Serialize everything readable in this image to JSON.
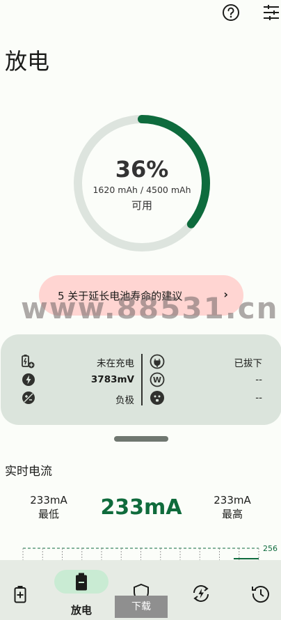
{
  "header": {
    "title": "放电",
    "help_icon": "help-circle-icon",
    "settings_icon": "tune-sliders-icon"
  },
  "gauge": {
    "percent_label": "36%",
    "percent": 36,
    "capacity": "1620 mAh / 4500 mAh",
    "available": "可用",
    "accent": "#0e6b3d",
    "track": "#dde4de"
  },
  "tips": {
    "label": "5 关于延长电池寿命的建议",
    "chevron": "›"
  },
  "watermark": {
    "text1": "www.88531.cn",
    "text2": "www.88531.cn"
  },
  "stats": {
    "charging_state": "未在充电",
    "voltage": "3783mV",
    "polarity": "负极",
    "plug_state": "已拔下",
    "watts": "--",
    "temperature": "--"
  },
  "current": {
    "title": "实时电流",
    "min_value": "233mA",
    "min_label": "最低",
    "now_value": "233mA",
    "max_value": "233mA",
    "max_label": "最高",
    "graph_max": "256"
  },
  "nav": {
    "items": [
      {
        "label": "",
        "icon": "battery-plus-icon"
      },
      {
        "label": "放电",
        "icon": "battery-minus-icon"
      },
      {
        "label": "",
        "icon": "shield-icon"
      },
      {
        "label": "",
        "icon": "bolt-cycle-icon"
      },
      {
        "label": "",
        "icon": "history-icon"
      }
    ],
    "download_badge": "下载"
  }
}
